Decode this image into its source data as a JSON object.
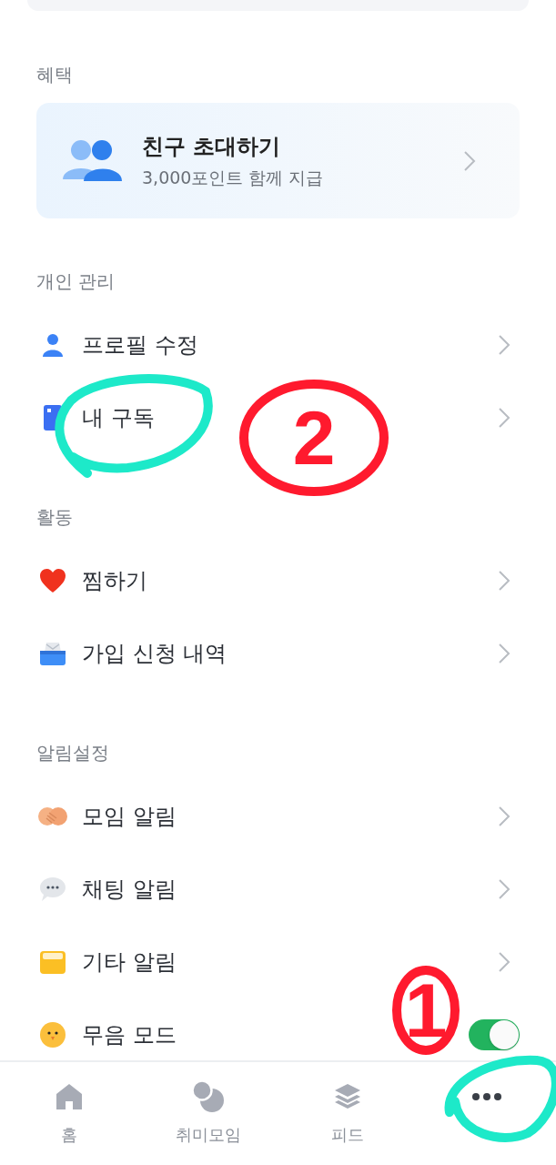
{
  "benefits": {
    "header": "혜택",
    "invite_card": {
      "title": "친구 초대하기",
      "subtitle": "3,000포인트 함께 지급"
    }
  },
  "sections": [
    {
      "header": "개인 관리",
      "items": [
        {
          "kind": "link",
          "label": "프로필 수정"
        },
        {
          "kind": "link",
          "label": "내 구독"
        }
      ]
    },
    {
      "header": "활동",
      "items": [
        {
          "kind": "link",
          "label": "찜하기"
        },
        {
          "kind": "link",
          "label": "가입 신청 내역"
        }
      ]
    },
    {
      "header": "알림설정",
      "items": [
        {
          "kind": "link",
          "label": "모임 알림"
        },
        {
          "kind": "link",
          "label": "채팅 알림"
        },
        {
          "kind": "link",
          "label": "기타 알림"
        },
        {
          "kind": "toggle",
          "label": "무음 모드",
          "on": true
        }
      ]
    }
  ],
  "tab_bar": {
    "tabs": [
      {
        "label": "홈",
        "selected": false
      },
      {
        "label": "취미모임",
        "selected": false
      },
      {
        "label": "피드",
        "selected": false
      },
      {
        "selected": true
      }
    ]
  },
  "annotations": [
    {
      "kind": "loop",
      "color": "#1de9c9"
    },
    {
      "kind": "numeral",
      "label": "2",
      "color": "#ff1a2e"
    },
    {
      "kind": "numeral",
      "label": "1",
      "color": "#ff1a2e"
    },
    {
      "kind": "loop",
      "color": "#1de9c9"
    }
  ]
}
